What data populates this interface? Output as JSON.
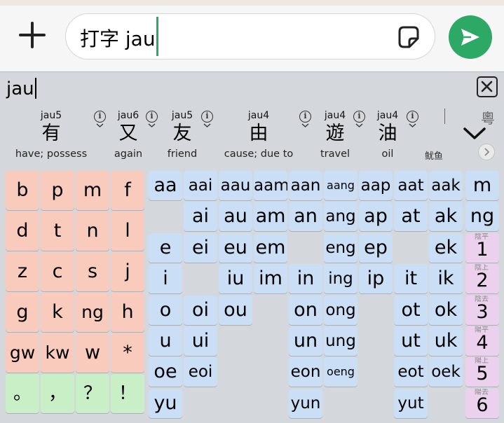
{
  "message_bar": {
    "input_text": "打字 jau"
  },
  "composition": {
    "text": "jau"
  },
  "candidates": [
    {
      "jyutping": "jau5",
      "char": "有",
      "gloss": "have; possess"
    },
    {
      "jyutping": "jau6",
      "char": "又",
      "gloss": "again"
    },
    {
      "jyutping": "jau5",
      "char": "友",
      "gloss": "friend"
    },
    {
      "jyutping": "jau4",
      "char": "由",
      "gloss": "cause; due to"
    },
    {
      "jyutping": "jau4",
      "char": "遊",
      "gloss": "travel"
    },
    {
      "jyutping": "jau4",
      "char": "油",
      "gloss": "oil"
    }
  ],
  "candidate_partial": {
    "gloss": "鱿鱼"
  },
  "region_label": "粵",
  "initial_keys": [
    [
      "b",
      "p",
      "m",
      "f"
    ],
    [
      "d",
      "t",
      "n",
      "l"
    ],
    [
      "z",
      "c",
      "s",
      "j"
    ],
    [
      "g",
      "k",
      "ng",
      "h"
    ],
    [
      "gw",
      "kw",
      "w",
      "*"
    ]
  ],
  "punct_keys": [
    "。",
    "，",
    "？",
    "！"
  ],
  "final_keys": [
    [
      {
        "col": 0,
        "t": "aa"
      },
      {
        "col": 1,
        "t": "aai"
      },
      {
        "col": 2,
        "t": "aau"
      },
      {
        "col": 3,
        "t": "aam"
      },
      {
        "col": 4,
        "t": "aan"
      },
      {
        "col": 5,
        "t": "aang"
      },
      {
        "col": 6,
        "t": "aap"
      },
      {
        "col": 7,
        "t": "aat"
      },
      {
        "col": 8,
        "t": "aak"
      },
      {
        "col": 9,
        "t": "m"
      }
    ],
    [
      {
        "col": 1,
        "t": "ai"
      },
      {
        "col": 2,
        "t": "au"
      },
      {
        "col": 3,
        "t": "am"
      },
      {
        "col": 4,
        "t": "an"
      },
      {
        "col": 5,
        "t": "ang"
      },
      {
        "col": 6,
        "t": "ap"
      },
      {
        "col": 7,
        "t": "at"
      },
      {
        "col": 8,
        "t": "ak"
      },
      {
        "col": 9,
        "t": "ng"
      }
    ],
    [
      {
        "col": 0,
        "t": "e"
      },
      {
        "col": 1,
        "t": "ei"
      },
      {
        "col": 2,
        "t": "eu"
      },
      {
        "col": 3,
        "t": "em"
      },
      {
        "col": 5,
        "t": "eng"
      },
      {
        "col": 6,
        "t": "ep"
      },
      {
        "col": 8,
        "t": "ek"
      }
    ],
    [
      {
        "col": 0,
        "t": "i"
      },
      {
        "col": 2,
        "t": "iu"
      },
      {
        "col": 3,
        "t": "im"
      },
      {
        "col": 4,
        "t": "in"
      },
      {
        "col": 5,
        "t": "ing"
      },
      {
        "col": 6,
        "t": "ip"
      },
      {
        "col": 7,
        "t": "it"
      },
      {
        "col": 8,
        "t": "ik"
      }
    ],
    [
      {
        "col": 0,
        "t": "o"
      },
      {
        "col": 1,
        "t": "oi"
      },
      {
        "col": 2,
        "t": "ou"
      },
      {
        "col": 4,
        "t": "on"
      },
      {
        "col": 5,
        "t": "ong"
      },
      {
        "col": 7,
        "t": "ot"
      },
      {
        "col": 8,
        "t": "ok"
      }
    ],
    [
      {
        "col": 0,
        "t": "u"
      },
      {
        "col": 1,
        "t": "ui"
      },
      {
        "col": 4,
        "t": "un"
      },
      {
        "col": 5,
        "t": "ung"
      },
      {
        "col": 7,
        "t": "ut"
      },
      {
        "col": 8,
        "t": "uk"
      }
    ],
    [
      {
        "col": 0,
        "t": "oe"
      },
      {
        "col": 1,
        "t": "eoi"
      },
      {
        "col": 4,
        "t": "eon"
      },
      {
        "col": 5,
        "t": "oeng"
      },
      {
        "col": 7,
        "t": "eot"
      },
      {
        "col": 8,
        "t": "oek"
      }
    ],
    [
      {
        "col": 0,
        "t": "yu"
      },
      {
        "col": 4,
        "t": "yun"
      },
      {
        "col": 7,
        "t": "yut"
      }
    ]
  ],
  "tone_keys": [
    {
      "digit": "1",
      "label": "陰平"
    },
    {
      "digit": "2",
      "label": "陰上"
    },
    {
      "digit": "3",
      "label": "陰去"
    },
    {
      "digit": "4",
      "label": "陽平"
    },
    {
      "digit": "5",
      "label": "陽上"
    },
    {
      "digit": "6",
      "label": "陽去"
    }
  ],
  "colors": {
    "accent_green": "#2ea865",
    "initial_key": "#f9cbbd",
    "punct_key": "#c9efc7",
    "final_key": "#cadff5",
    "tone_key": "#ecd1ee",
    "keyboard_bg": "#d4d7dc"
  }
}
